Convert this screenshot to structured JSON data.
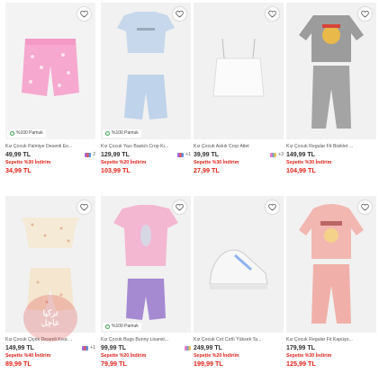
{
  "products": [
    {
      "name": "Kız Çocuk Palmiye Desenli Es...",
      "price": "49,99 TL",
      "colors": "2",
      "promo": "Sepette %30 İndirim",
      "sale": "34,99 TL",
      "badge": "%100 Pamuk",
      "colors_shown": true
    },
    {
      "name": "Kız Çocuk Yazı Baskılı Crop Kı...",
      "price": "129,99 TL",
      "colors": "+1",
      "promo": "Sepette %20 İndirim",
      "sale": "103,99 TL",
      "badge": "%100 Pamuk",
      "colors_shown": true
    },
    {
      "name": "Kız Çocuk Askılı Crop Atlet",
      "price": "39,99 TL",
      "colors": "+3",
      "promo": "Sepette %30 İndirim",
      "sale": "27,99 TL",
      "badge": "",
      "colors_shown": true
    },
    {
      "name": "Kız Çocuk Regular Fit Bisiklet ...",
      "price": "149,99 TL",
      "colors": "",
      "promo": "Sepette %30 İndirim",
      "sale": "104,99 TL",
      "badge": "",
      "colors_shown": false
    },
    {
      "name": "Kız Çocuk Çiçek Desenli Kısa ...",
      "price": "149,99 TL",
      "colors": "+1",
      "promo": "Sepette %40 İndirim",
      "sale": "89,99 TL",
      "badge": "",
      "colors_shown": true
    },
    {
      "name": "Kız Çocuk Bugs Bunny Lisansl...",
      "price": "99,99 TL",
      "colors": "",
      "promo": "Sepette %20 İndirim",
      "sale": "79,99 TL",
      "badge": "%100 Pamuk",
      "colors_shown": true
    },
    {
      "name": "Kız Çocuk Cırt Cırtlı Yüksek Ta...",
      "price": "249,99 TL",
      "colors": "",
      "promo": "Sepette %20 İndirim",
      "sale": "199,99 TL",
      "badge": "",
      "colors_shown": false
    },
    {
      "name": "Kız Çocuk Regular Fit Kapüşo...",
      "price": "179,99 TL",
      "colors": "",
      "promo": "Sepette %30 İndirim",
      "sale": "125,99 TL",
      "badge": "",
      "colors_shown": false
    }
  ],
  "watermark": {
    "line1": "تركيا",
    "line2": "عاجل"
  },
  "accent_color": "#e2231a"
}
